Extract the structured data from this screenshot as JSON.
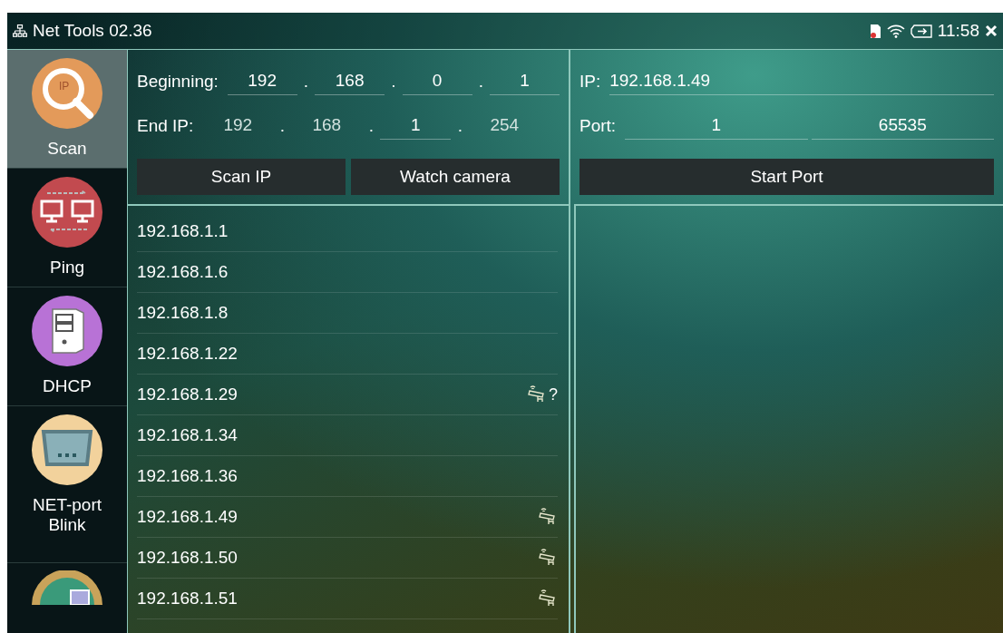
{
  "window": {
    "title": "Net Tools 02.36"
  },
  "status_bar": {
    "time": "11:58"
  },
  "sidebar": {
    "items": [
      {
        "kind": "scan",
        "icon_text": "IP",
        "label": "Scan",
        "selected": true
      },
      {
        "kind": "ping",
        "label": "Ping",
        "selected": false
      },
      {
        "kind": "dhcp",
        "label": "DHCP",
        "selected": false
      },
      {
        "kind": "netport",
        "label": "NET-port Blink",
        "selected": false
      },
      {
        "kind": "globe",
        "selected": false
      }
    ]
  },
  "ip_range": {
    "beginning": {
      "label": "Beginning:",
      "octets": [
        {
          "value": "192",
          "disabled": false
        },
        {
          "value": "168",
          "disabled": false
        },
        {
          "value": "0",
          "disabled": false
        },
        {
          "value": "1",
          "disabled": false
        }
      ]
    },
    "end": {
      "label": "End IP:",
      "octets": [
        {
          "value": "192",
          "disabled": true
        },
        {
          "value": "168",
          "disabled": true
        },
        {
          "value": "1",
          "disabled": false
        },
        {
          "value": "254",
          "disabled": true
        }
      ]
    },
    "separator": "."
  },
  "buttons": [
    "Scan IP",
    "Watch camera"
  ],
  "port_scan": {
    "ip_label": "IP:",
    "ip": "192.168.1.49",
    "port_label": "Port:",
    "port_from": "1",
    "port_to": "65535",
    "button": "Start Port"
  },
  "hosts": [
    {
      "ip": "192.168.1.1",
      "camera": false
    },
    {
      "ip": "192.168.1.6",
      "camera": false
    },
    {
      "ip": "192.168.1.8",
      "camera": false
    },
    {
      "ip": "192.168.1.22",
      "camera": false
    },
    {
      "ip": "192.168.1.29",
      "camera": true,
      "mark": "?"
    },
    {
      "ip": "192.168.1.34",
      "camera": false
    },
    {
      "ip": "192.168.1.36",
      "camera": false
    },
    {
      "ip": "192.168.1.49",
      "camera": true
    },
    {
      "ip": "192.168.1.50",
      "camera": true
    },
    {
      "ip": "192.168.1.51",
      "camera": true
    }
  ]
}
